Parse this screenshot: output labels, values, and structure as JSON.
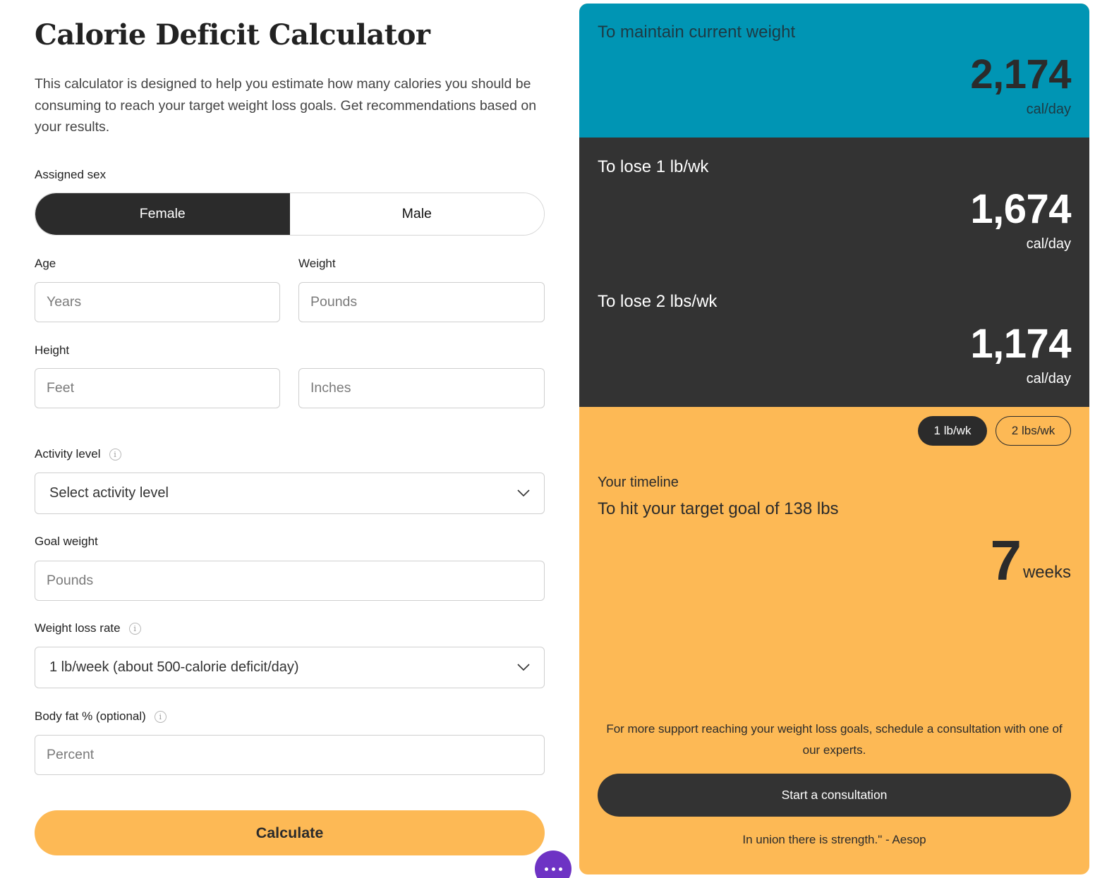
{
  "page": {
    "title": "Calorie Deficit Calculator",
    "intro": "This calculator is designed to help you estimate how many calories you should be consuming to reach your target weight loss goals. Get recommendations based on your results."
  },
  "form": {
    "sex": {
      "label": "Assigned sex",
      "options": [
        "Female",
        "Male"
      ],
      "selected": "Female"
    },
    "age": {
      "label": "Age",
      "placeholder": "Years",
      "value": ""
    },
    "weight": {
      "label": "Weight",
      "placeholder": "Pounds",
      "value": ""
    },
    "height": {
      "label": "Height",
      "feet_placeholder": "Feet",
      "inches_placeholder": "Inches"
    },
    "activity": {
      "label": "Activity level",
      "selected": "Select activity level"
    },
    "goal_weight": {
      "label": "Goal weight",
      "placeholder": "Pounds",
      "value": ""
    },
    "rate": {
      "label": "Weight loss rate",
      "selected": "1 lb/week (about 500-calorie deficit/day)"
    },
    "body_fat": {
      "label": "Body fat % (optional)",
      "placeholder": "Percent",
      "value": ""
    },
    "calculate_label": "Calculate",
    "info_glyph": "i"
  },
  "results": {
    "maintain": {
      "label": "To maintain current weight",
      "value": "2,174",
      "unit": "cal/day"
    },
    "lose1": {
      "label": "To lose 1 lb/wk",
      "value": "1,674",
      "unit": "cal/day"
    },
    "lose2": {
      "label": "To lose 2 lbs/wk",
      "value": "1,174",
      "unit": "cal/day"
    },
    "rate_toggle": {
      "options": [
        "1 lb/wk",
        "2 lbs/wk"
      ],
      "selected": "1 lb/wk"
    },
    "timeline": {
      "label": "Your timeline",
      "goal_text": "To hit your target goal of 138 lbs",
      "weeks_value": "7",
      "weeks_unit": "weeks"
    },
    "support_text": "For more support reaching your weight loss goals, schedule a consultation with one of our experts.",
    "consult_label": "Start a consultation",
    "quote": "In union there is strength.\" - Aesop"
  },
  "colors": {
    "accent_orange": "#fdb955",
    "maintain_teal": "#0095b4",
    "dark": "#333333",
    "chat_purple": "#6e33c4"
  },
  "icons": {
    "info": "info-icon",
    "chevron": "chevron-down-icon",
    "more": "more-dots-icon"
  }
}
